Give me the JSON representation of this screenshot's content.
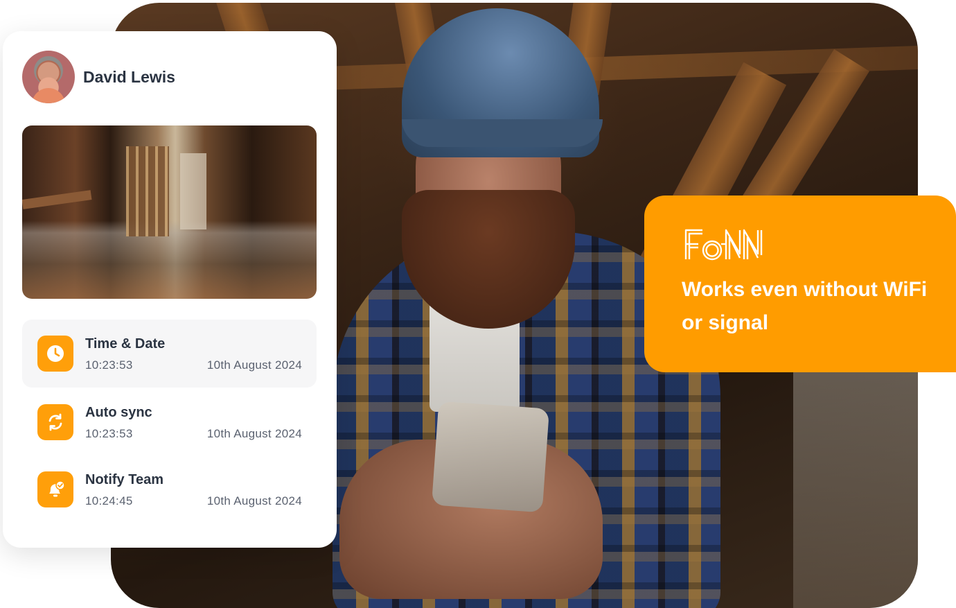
{
  "profile": {
    "name": "David Lewis",
    "avatar_icon": "user-avatar"
  },
  "activity": [
    {
      "title": "Time & Date",
      "time": "10:23:53",
      "date": "10th August 2024",
      "icon": "clock-icon"
    },
    {
      "title": "Auto sync",
      "time": "10:23:53",
      "date": "10th August 2024",
      "icon": "sync-icon"
    },
    {
      "title": "Notify Team",
      "time": "10:24:45",
      "date": "10th August 2024",
      "icon": "bell-check-icon"
    }
  ],
  "callout": {
    "brand": "FONN",
    "message": "Works even without WiFi or signal"
  },
  "colors": {
    "accent": "#ff9c00",
    "icon_bg": "#ff9f0a",
    "text_dark": "#2b3442",
    "text_muted": "#5b6270"
  }
}
